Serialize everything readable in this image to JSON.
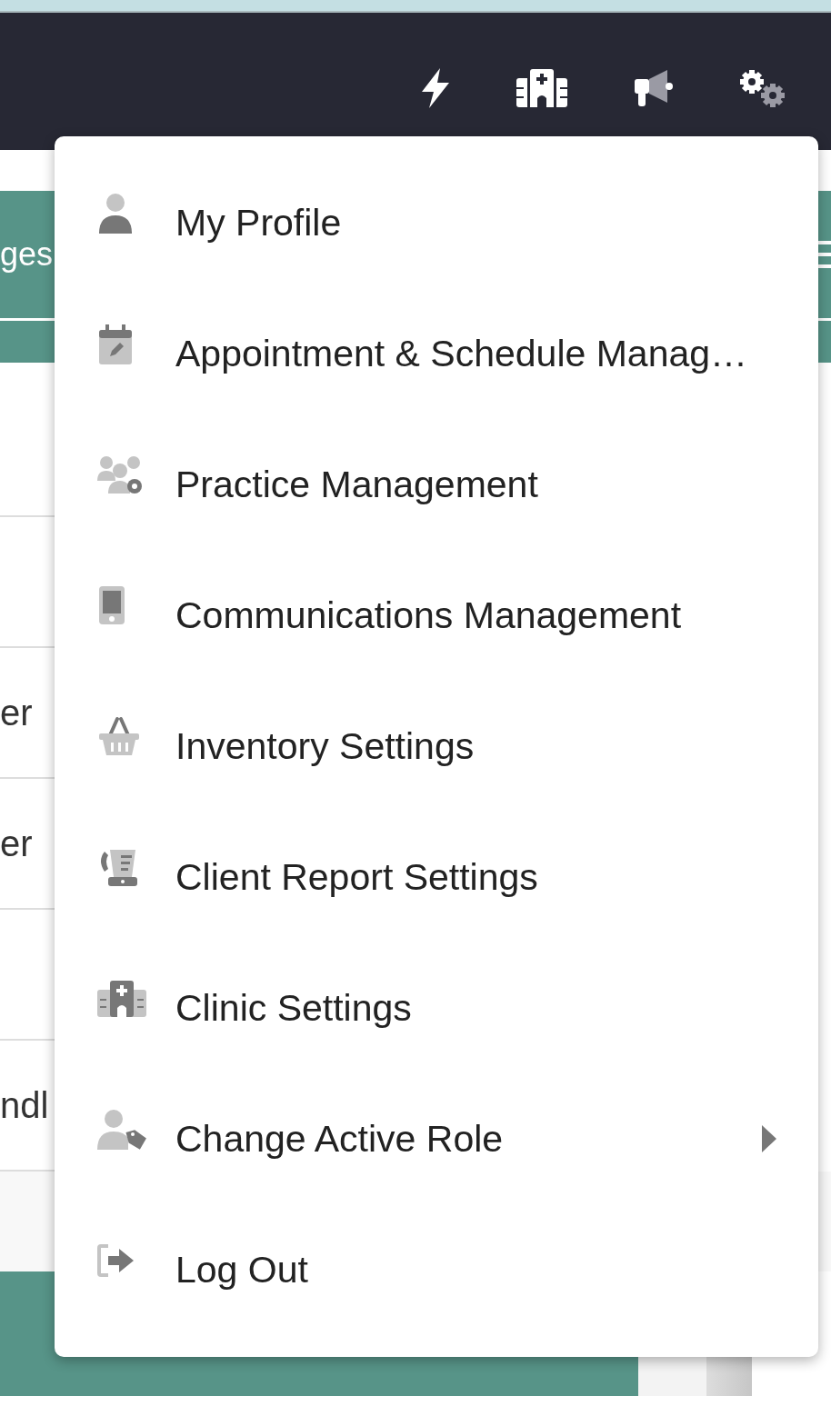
{
  "background": {
    "header_text": "ges",
    "rows": [
      "",
      "",
      "er",
      "er",
      "",
      "ndl"
    ]
  },
  "menu": {
    "items": [
      {
        "label": "My Profile",
        "submenu": false
      },
      {
        "label": "Appointment & Schedule Manag…",
        "submenu": false
      },
      {
        "label": "Practice Management",
        "submenu": false
      },
      {
        "label": "Communications Management",
        "submenu": false
      },
      {
        "label": "Inventory Settings",
        "submenu": false
      },
      {
        "label": "Client Report Settings",
        "submenu": false
      },
      {
        "label": "Clinic Settings",
        "submenu": false
      },
      {
        "label": "Change Active Role",
        "submenu": true
      },
      {
        "label": "Log Out",
        "submenu": false
      }
    ]
  }
}
